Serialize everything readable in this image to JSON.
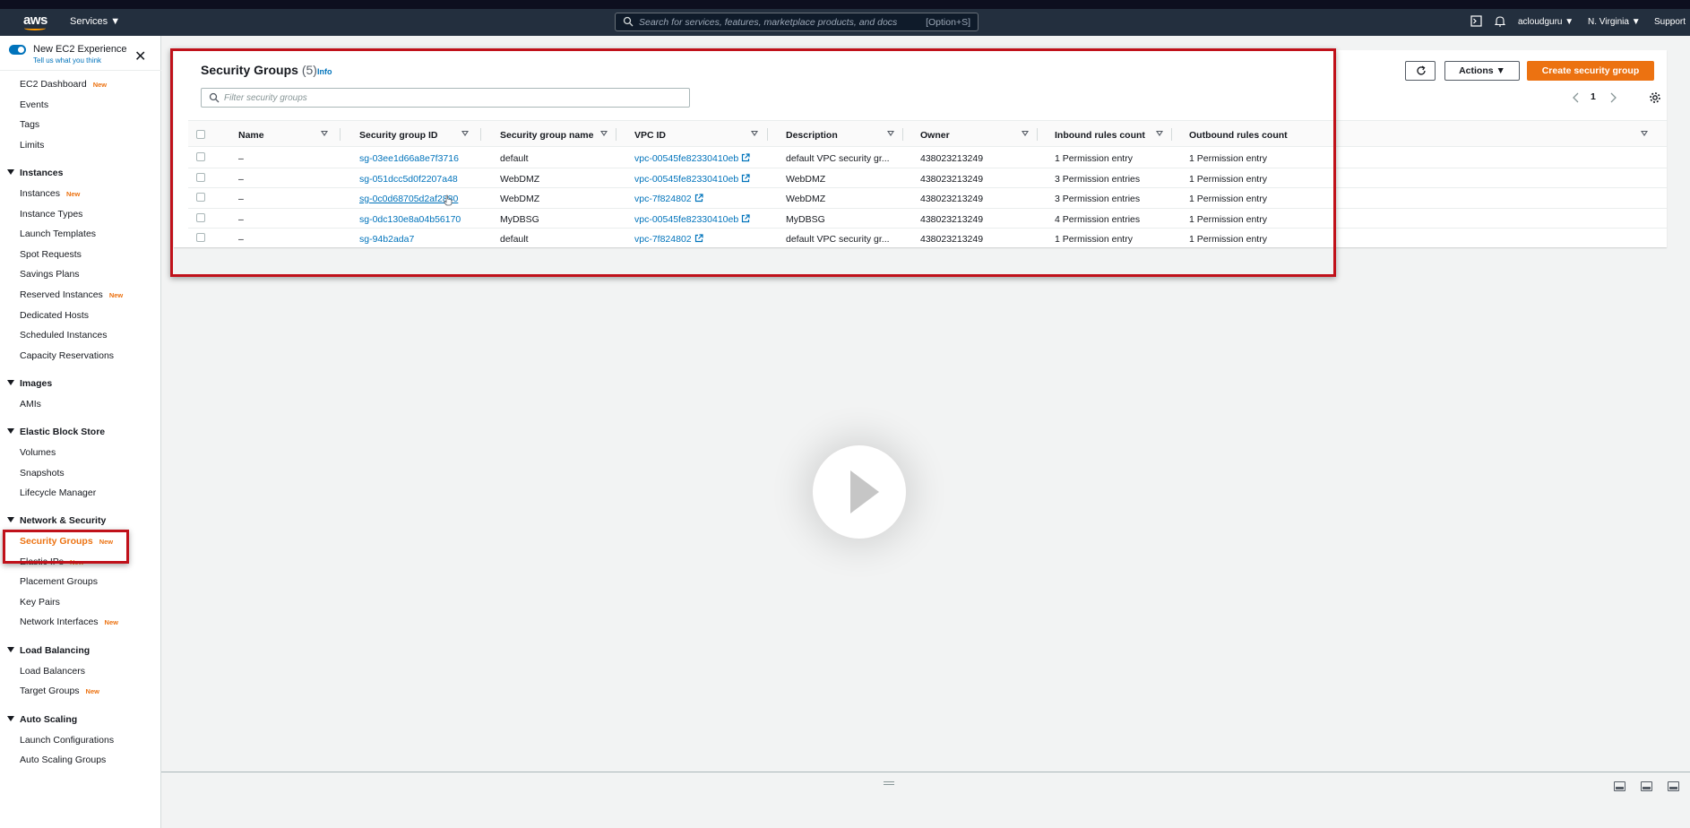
{
  "topnav": {
    "logo": "aws",
    "services_label": "Services",
    "search_placeholder": "Search for services, features, marketplace products, and docs",
    "search_shortcut": "[Option+S]",
    "account": "acloudguru",
    "region": "N. Virginia",
    "support": "Support"
  },
  "sidebar": {
    "experience_title": "New EC2 Experience",
    "experience_sub": "Tell us what you think",
    "new_badge": "New",
    "top_items": [
      {
        "label": "EC2 Dashboard",
        "new": true
      },
      {
        "label": "Events",
        "new": false
      },
      {
        "label": "Tags",
        "new": false
      },
      {
        "label": "Limits",
        "new": false
      }
    ],
    "sections": [
      {
        "title": "Instances",
        "items": [
          "Instances",
          "Instance Types",
          "Launch Templates",
          "Spot Requests",
          "Savings Plans",
          "Reserved Instances",
          "Dedicated Hosts",
          "Scheduled Instances",
          "Capacity Reservations"
        ]
      },
      {
        "title": "Images",
        "items": [
          "AMIs"
        ]
      },
      {
        "title": "Elastic Block Store",
        "items": [
          "Volumes",
          "Snapshots",
          "Lifecycle Manager"
        ]
      },
      {
        "title": "Network & Security",
        "items": [
          "Security Groups",
          "Elastic IPs",
          "Placement Groups",
          "Key Pairs",
          "Network Interfaces"
        ]
      },
      {
        "title": "Load Balancing",
        "items": [
          "Load Balancers",
          "Target Groups"
        ]
      },
      {
        "title": "Auto Scaling",
        "items": [
          "Launch Configurations",
          "Auto Scaling Groups"
        ]
      }
    ]
  },
  "panel": {
    "title": "Security Groups",
    "count": "(5)",
    "info": "Info",
    "filter_placeholder": "Filter security groups",
    "actions_label": "Actions",
    "create_label": "Create security group",
    "page_number": "1",
    "columns": [
      "Name",
      "Security group ID",
      "Security group name",
      "VPC ID",
      "Description",
      "Owner",
      "Inbound rules count",
      "Outbound rules count"
    ],
    "rows": [
      {
        "name": "–",
        "sg_id": "sg-03ee1d66a8e7f3716",
        "sg_name": "default",
        "vpc": "vpc-00545fe82330410eb",
        "desc": "default VPC security gr...",
        "owner": "438023213249",
        "inbound": "1 Permission entry",
        "outbound": "1 Permission entry"
      },
      {
        "name": "–",
        "sg_id": "sg-051dcc5d0f2207a48",
        "sg_name": "WebDMZ",
        "vpc": "vpc-00545fe82330410eb",
        "desc": "WebDMZ",
        "owner": "438023213249",
        "inbound": "3 Permission entries",
        "outbound": "1 Permission entry"
      },
      {
        "name": "–",
        "sg_id": "sg-0c0d68705d2af2880",
        "sg_name": "WebDMZ",
        "vpc": "vpc-7f824802",
        "desc": "WebDMZ",
        "owner": "438023213249",
        "inbound": "3 Permission entries",
        "outbound": "1 Permission entry"
      },
      {
        "name": "–",
        "sg_id": "sg-0dc130e8a04b56170",
        "sg_name": "MyDBSG",
        "vpc": "vpc-00545fe82330410eb",
        "desc": "MyDBSG",
        "owner": "438023213249",
        "inbound": "4 Permission entries",
        "outbound": "1 Permission entry"
      },
      {
        "name": "–",
        "sg_id": "sg-94b2ada7",
        "sg_name": "default",
        "vpc": "vpc-7f824802",
        "desc": "default VPC security gr...",
        "owner": "438023213249",
        "inbound": "1 Permission entry",
        "outbound": "1 Permission entry"
      }
    ]
  },
  "colors": {
    "accent": "#ec7211",
    "link": "#0073bb",
    "nav_bg": "#232f3e",
    "highlight": "#c0111a"
  }
}
